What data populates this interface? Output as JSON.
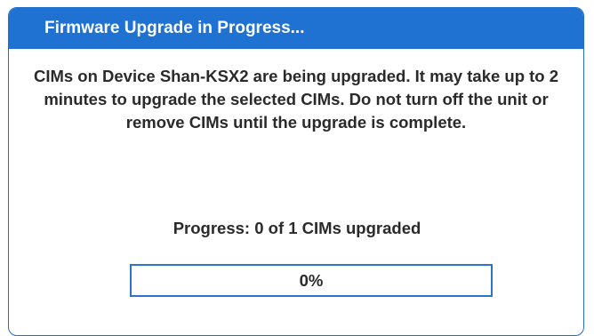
{
  "dialog": {
    "title": "Firmware Upgrade in Progress...",
    "message": "CIMs on Device Shan-KSX2 are being upgraded. It may take up to 2 minutes to upgrade the selected CIMs. Do not turn off the unit or remove CIMs until the upgrade is complete.",
    "progress_text": "Progress: 0 of 1 CIMs upgraded",
    "progress_label": "0%",
    "progress_fraction": 0
  },
  "colors": {
    "header_background": "#1f72d2",
    "header_text": "#ffffff",
    "border": "#1f6fc9",
    "progress_border": "#2d73c7",
    "body_text": "#2a2a2a"
  }
}
